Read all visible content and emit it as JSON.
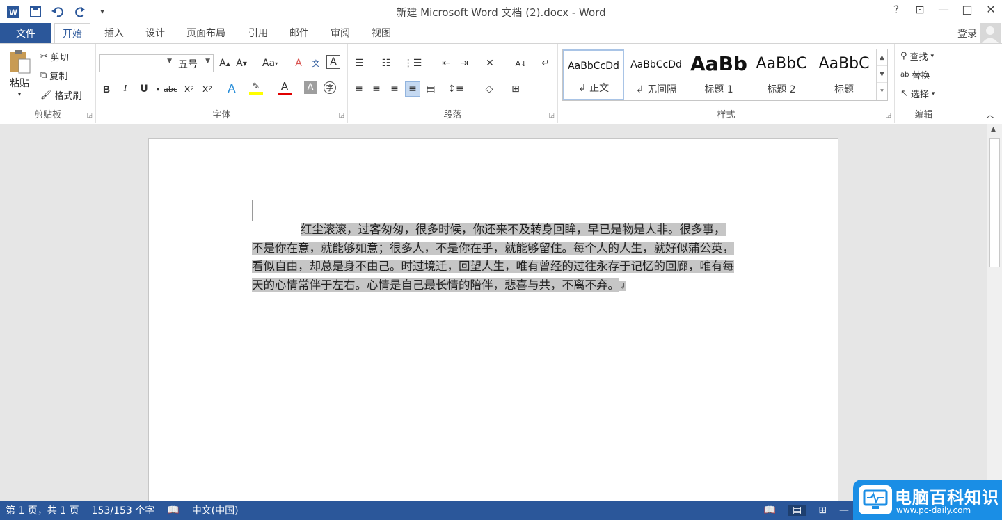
{
  "title_bar": {
    "title": "新建 Microsoft Word 文档 (2).docx - Word",
    "help": "?",
    "buttons": {
      "minimize": "—",
      "maximize": "□",
      "close": "✕",
      "ribbon_display": "⊡"
    }
  },
  "ribbon_tabs": {
    "file": "文件",
    "items": [
      "开始",
      "插入",
      "设计",
      "页面布局",
      "引用",
      "邮件",
      "审阅",
      "视图"
    ],
    "active": "开始",
    "login": "登录"
  },
  "groups": {
    "clipboard": {
      "label": "剪贴板",
      "paste": "粘贴",
      "cut": "剪切",
      "copy": "复制",
      "format_painter": "格式刷"
    },
    "font": {
      "label": "字体",
      "font_name": "",
      "font_size": "五号",
      "change_case": "Aa"
    },
    "paragraph": {
      "label": "段落"
    },
    "styles": {
      "label": "样式",
      "items": [
        {
          "preview": "AaBbCcDd",
          "name": "↲ 正文"
        },
        {
          "preview": "AaBbCcDd",
          "name": "↲ 无间隔"
        },
        {
          "preview": "AaBb",
          "name": "标题 1"
        },
        {
          "preview": "AaBbC",
          "name": "标题 2"
        },
        {
          "preview": "AaBbC",
          "name": "标题"
        }
      ]
    },
    "editing": {
      "label": "编辑",
      "find": "查找",
      "replace": "替换",
      "select": "选择"
    }
  },
  "document": {
    "paragraph": "红尘滚滚，过客匆匆，很多时候，你还来不及转身回眸，早已是物是人非。很多事，不是你在意，就能够如意；很多人，不是你在乎，就能够留住。每个人的人生，就好似蒲公英，看似自由，却总是身不由己。时过境迁，回望人生，唯有曾经的过往永存于记忆的回廊，唯有每天的心情常伴于左右。心情是自己最长情的陪伴，悲喜与共，不离不弃。",
    "paragraph_mark": "↲"
  },
  "status_bar": {
    "page": "第 1 页，共 1 页",
    "word_count": "153/153 个字",
    "language": "中文(中国)"
  },
  "watermark": {
    "title": "电脑百科知识",
    "url": "www.pc-daily.com"
  },
  "colors": {
    "brand": "#2b579a",
    "highlight": "#c6c6c6",
    "font_color_bar": "#e00000",
    "highlight_bar": "#ffff00"
  }
}
